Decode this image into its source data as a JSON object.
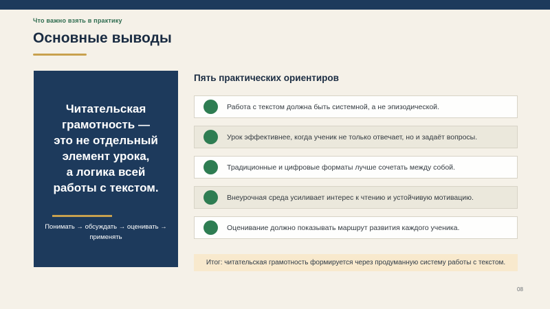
{
  "page": {
    "eyebrow": "Что важно взять в практику",
    "title": "Основные выводы",
    "page_number": "08"
  },
  "left_card": {
    "statement": "Читательская\nграмотность —\nэто не отдельный\nэлемент урока,\nа логика всей\nработы с текстом.",
    "process": "Понимать → обсуждать → оценивать → применять"
  },
  "right": {
    "heading": "Пять практических ориентиров",
    "items": [
      "Работа с текстом должна быть системной, а не эпизодической.",
      "Урок эффективнее, когда ученик не только отвечает, но и задаёт вопросы.",
      "Традиционные и цифровые форматы лучше сочетать между собой.",
      "Внеурочная среда усиливает интерес к чтению и устойчивую мотивацию.",
      "Оценивание должно показывать маршрут развития каждого ученика."
    ],
    "summary": "Итог: читательская грамотность формируется через продуманную систему работы с текстом."
  },
  "colors": {
    "navy": "#1d3a5c",
    "gold": "#c8a14e",
    "green_bullet": "#2e7d52",
    "green_label": "#2d6b4e",
    "background_cream": "#f5f1e8",
    "card_beige": "#ebe8dc",
    "summary_tan": "#f8e9cd",
    "title_dark": "#1a2c42"
  }
}
